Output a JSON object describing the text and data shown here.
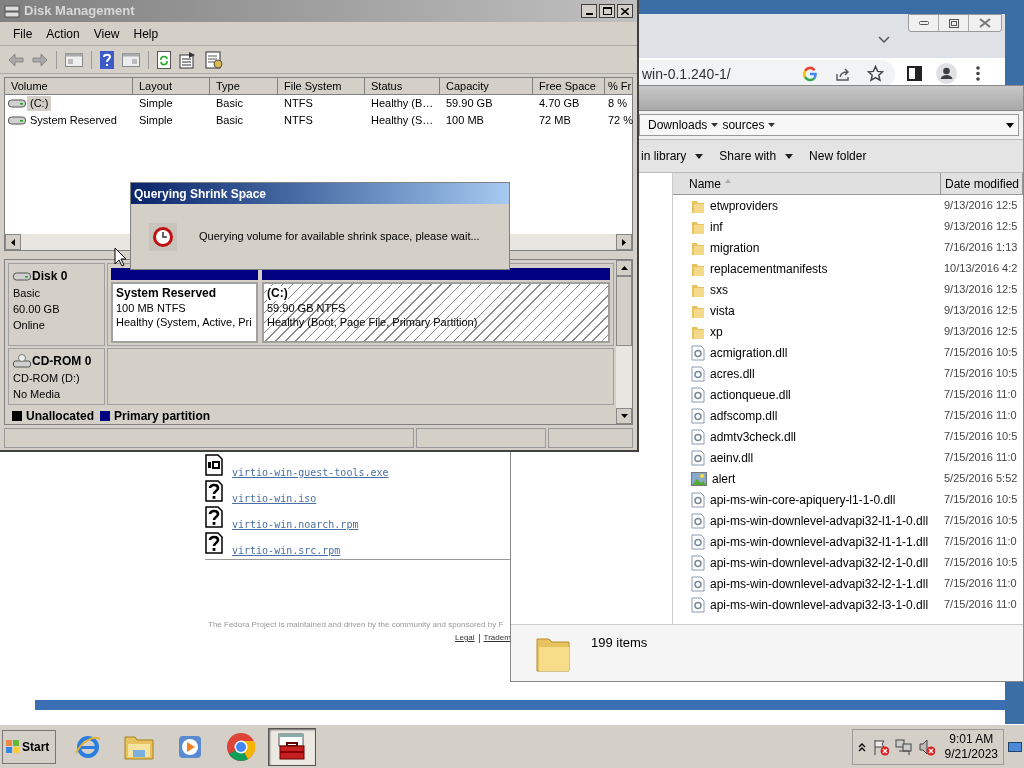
{
  "browser": {
    "address": "win-0.1.240-1/",
    "files": [
      {
        "kind": "binary",
        "name": "virtio-win-guest-tools.exe"
      },
      {
        "kind": "unknown",
        "name": "virtio-win.iso"
      },
      {
        "kind": "unknown",
        "name": "virtio-win.noarch.rpm"
      },
      {
        "kind": "unknown",
        "name": "virtio-win.src.rpm"
      }
    ],
    "footer": "The Fedora Project is maintained and driven by the community and sponsored by F",
    "footer_links": [
      "Legal",
      "Tradem"
    ]
  },
  "explorer": {
    "breadcrumb": [
      "Downloads",
      "sources"
    ],
    "commands": [
      {
        "label": "in library",
        "kind": "menu"
      },
      {
        "label": "Share with",
        "kind": "menu"
      },
      {
        "label": "New folder",
        "kind": "button"
      }
    ],
    "columns": [
      "Name",
      "Date modified"
    ],
    "items": [
      {
        "kind": "folder",
        "name": "etwproviders",
        "date": "9/13/2016 12:5"
      },
      {
        "kind": "folder",
        "name": "inf",
        "date": "9/13/2016 12:5"
      },
      {
        "kind": "folder",
        "name": "migration",
        "date": "7/16/2016 1:13"
      },
      {
        "kind": "folder",
        "name": "replacementmanifests",
        "date": "10/13/2016 4:2"
      },
      {
        "kind": "folder",
        "name": "sxs",
        "date": "9/13/2016 12:5"
      },
      {
        "kind": "folder",
        "name": "vista",
        "date": "9/13/2016 12:5"
      },
      {
        "kind": "folder",
        "name": "xp",
        "date": "9/13/2016 12:5"
      },
      {
        "kind": "dll",
        "name": "acmigration.dll",
        "date": "7/15/2016 10:5"
      },
      {
        "kind": "dll",
        "name": "acres.dll",
        "date": "7/15/2016 10:5"
      },
      {
        "kind": "dll",
        "name": "actionqueue.dll",
        "date": "7/15/2016 11:0"
      },
      {
        "kind": "dll",
        "name": "adfscomp.dll",
        "date": "7/15/2016 11:0"
      },
      {
        "kind": "dll",
        "name": "admtv3check.dll",
        "date": "7/15/2016 10:5"
      },
      {
        "kind": "dll",
        "name": "aeinv.dll",
        "date": "7/15/2016 11:0"
      },
      {
        "kind": "image",
        "name": "alert",
        "date": "5/25/2016 5:52"
      },
      {
        "kind": "dll",
        "name": "api-ms-win-core-apiquery-l1-1-0.dll",
        "date": "7/15/2016 10:5"
      },
      {
        "kind": "dll",
        "name": "api-ms-win-downlevel-advapi32-l1-1-0.dll",
        "date": "7/15/2016 10:5"
      },
      {
        "kind": "dll",
        "name": "api-ms-win-downlevel-advapi32-l1-1-1.dll",
        "date": "7/15/2016 11:0"
      },
      {
        "kind": "dll",
        "name": "api-ms-win-downlevel-advapi32-l2-1-0.dll",
        "date": "7/15/2016 10:5"
      },
      {
        "kind": "dll",
        "name": "api-ms-win-downlevel-advapi32-l2-1-1.dll",
        "date": "7/15/2016 11:0"
      },
      {
        "kind": "dll",
        "name": "api-ms-win-downlevel-advapi32-l3-1-0.dll",
        "date": "7/15/2016 11:0"
      }
    ],
    "status": "199 items"
  },
  "disk_management": {
    "title": "Disk Management",
    "menu": [
      "File",
      "Action",
      "View",
      "Help"
    ],
    "columns": [
      "Volume",
      "Layout",
      "Type",
      "File System",
      "Status",
      "Capacity",
      "Free Space",
      "% Fr"
    ],
    "volumes": [
      {
        "selected": true,
        "cells": [
          "(C:)",
          "Simple",
          "Basic",
          "NTFS",
          "Healthy (B…",
          "59.90 GB",
          "4.70 GB",
          "8 %"
        ]
      },
      {
        "selected": false,
        "cells": [
          "System Reserved",
          "Simple",
          "Basic",
          "NTFS",
          "Healthy (S…",
          "100 MB",
          "72 MB",
          "72 %"
        ]
      }
    ],
    "disks": [
      {
        "kind": "disk",
        "name": "Disk 0",
        "lines": [
          "Basic",
          "60.00 GB",
          "Online"
        ],
        "partitions": [
          {
            "name": "System Reserved",
            "size": "100 MB NTFS",
            "status": "Healthy (System, Active, Pri",
            "selected": false
          },
          {
            "name": "(C:)",
            "size": "59.90 GB NTFS",
            "status": "Healthy (Boot, Page File, Primary Partition)",
            "selected": true
          }
        ]
      },
      {
        "kind": "cdrom",
        "name": "CD-ROM 0",
        "lines": [
          "CD-ROM (D:)",
          "No Media"
        ]
      }
    ],
    "legend": [
      {
        "label": "Unallocated",
        "color": "#000000"
      },
      {
        "label": "Primary partition",
        "color": "#000080"
      }
    ]
  },
  "dialog": {
    "title": "Querying Shrink Space",
    "message": "Querying volume for available shrink space, please wait..."
  },
  "taskbar": {
    "start": "Start",
    "tasks": [
      {
        "kind": "ie",
        "selected": false
      },
      {
        "kind": "explorer",
        "selected": false
      },
      {
        "kind": "media",
        "selected": false
      },
      {
        "kind": "chrome",
        "selected": false
      },
      {
        "kind": "toolbox",
        "selected": true
      }
    ],
    "clock": {
      "time": "9:01 AM",
      "date": "9/21/2023"
    }
  }
}
